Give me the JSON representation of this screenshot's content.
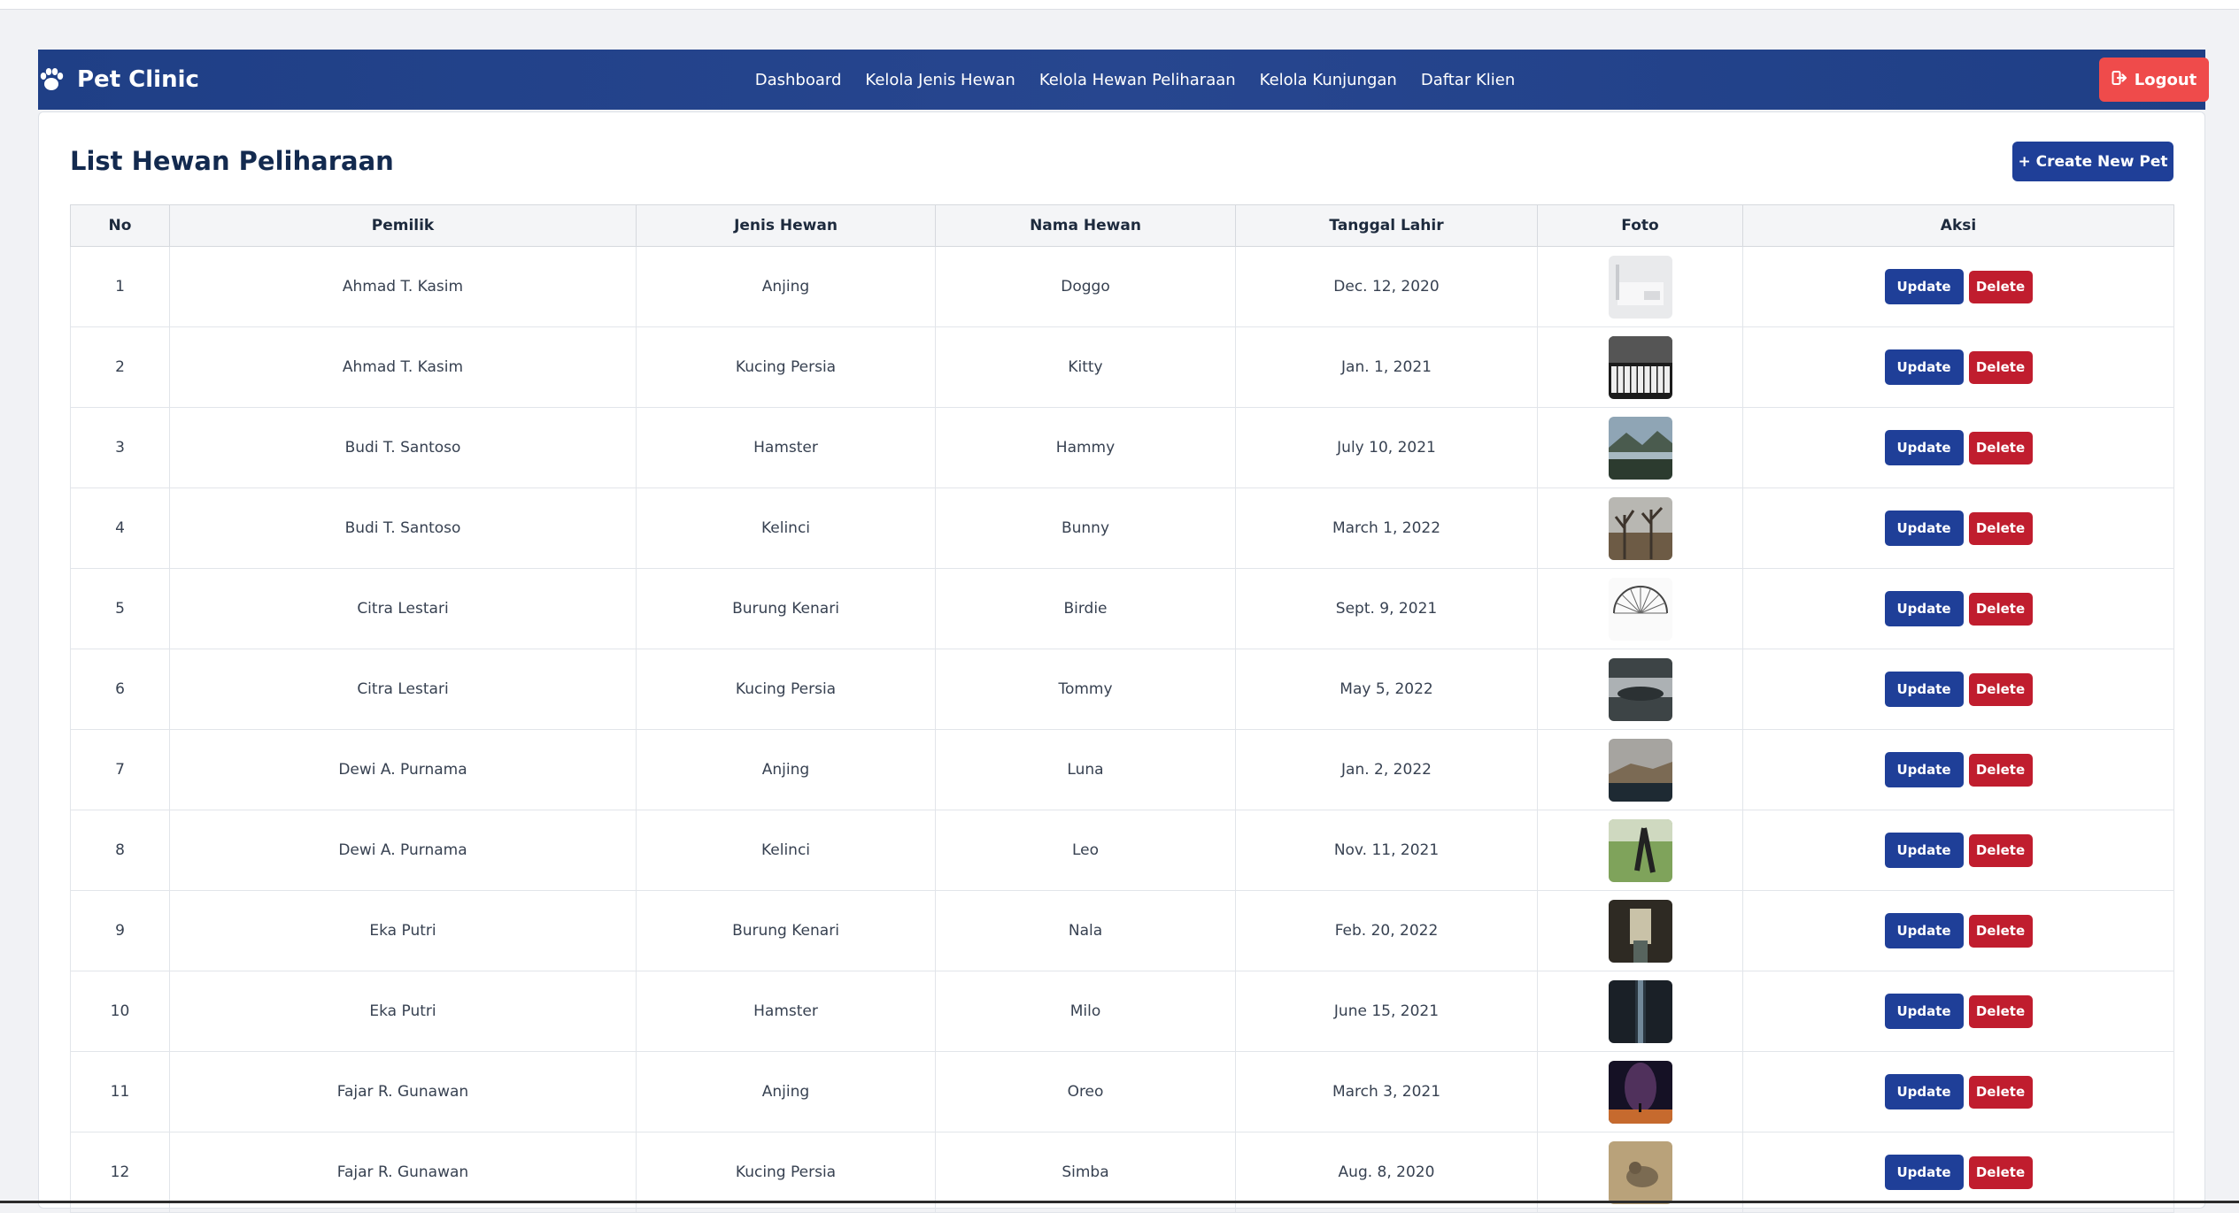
{
  "app": {
    "brand": "Pet Clinic",
    "brand_icon": "paw-icon"
  },
  "nav": {
    "links": [
      "Dashboard",
      "Kelola Jenis Hewan",
      "Kelola Hewan Peliharaan",
      "Kelola Kunjungan",
      "Daftar Klien"
    ],
    "logout_label": "Logout"
  },
  "page": {
    "title": "List Hewan Peliharaan",
    "create_label": "+ Create New Pet"
  },
  "table": {
    "headers": [
      "No",
      "Pemilik",
      "Jenis Hewan",
      "Nama Hewan",
      "Tanggal Lahir",
      "Foto",
      "Aksi"
    ],
    "update_label": "Update",
    "delete_label": "Delete",
    "rows": [
      {
        "no": "1",
        "pemilik": "Ahmad T. Kasim",
        "jenis": "Anjing",
        "nama": "Doggo",
        "tanggal": "Dec. 12, 2020",
        "photo": "photo-interior-white"
      },
      {
        "no": "2",
        "pemilik": "Ahmad T. Kasim",
        "jenis": "Kucing Persia",
        "nama": "Kitty",
        "tanggal": "Jan. 1, 2021",
        "photo": "photo-piano-keys"
      },
      {
        "no": "3",
        "pemilik": "Budi T. Santoso",
        "jenis": "Hamster",
        "nama": "Hammy",
        "tanggal": "July 10, 2021",
        "photo": "photo-lake-mountains"
      },
      {
        "no": "4",
        "pemilik": "Budi T. Santoso",
        "jenis": "Kelinci",
        "nama": "Bunny",
        "tanggal": "March 1, 2022",
        "photo": "photo-bare-trees"
      },
      {
        "no": "5",
        "pemilik": "Citra Lestari",
        "jenis": "Burung Kenari",
        "nama": "Birdie",
        "tanggal": "Sept. 9, 2021",
        "photo": "photo-ferris-wheel"
      },
      {
        "no": "6",
        "pemilik": "Citra Lestari",
        "jenis": "Kucing Persia",
        "nama": "Tommy",
        "tanggal": "May 5, 2022",
        "photo": "photo-foggy-island"
      },
      {
        "no": "7",
        "pemilik": "Dewi A. Purnama",
        "jenis": "Anjing",
        "nama": "Luna",
        "tanggal": "Jan. 2, 2022",
        "photo": "photo-coast-cliffs"
      },
      {
        "no": "8",
        "pemilik": "Dewi A. Purnama",
        "jenis": "Kelinci",
        "nama": "Leo",
        "tanggal": "Nov. 11, 2021",
        "photo": "photo-runner-park"
      },
      {
        "no": "9",
        "pemilik": "Eka Putri",
        "jenis": "Burung Kenari",
        "nama": "Nala",
        "tanggal": "Feb. 20, 2022",
        "photo": "photo-canal-street"
      },
      {
        "no": "10",
        "pemilik": "Eka Putri",
        "jenis": "Hamster",
        "nama": "Milo",
        "tanggal": "June 15, 2021",
        "photo": "photo-light-corridor"
      },
      {
        "no": "11",
        "pemilik": "Fajar R. Gunawan",
        "jenis": "Anjing",
        "nama": "Oreo",
        "tanggal": "March 3, 2021",
        "photo": "photo-night-sky"
      },
      {
        "no": "12",
        "pemilik": "Fajar R. Gunawan",
        "jenis": "Kucing Persia",
        "nama": "Simba",
        "tanggal": "Aug. 8, 2020",
        "photo": "photo-wild-cat"
      }
    ]
  },
  "colors": {
    "navbar": "#1f3f86",
    "primary_button": "#1f3f98",
    "logout_button": "#ef4b4b",
    "delete_button": "#c01d2e",
    "title": "#132a4f"
  }
}
